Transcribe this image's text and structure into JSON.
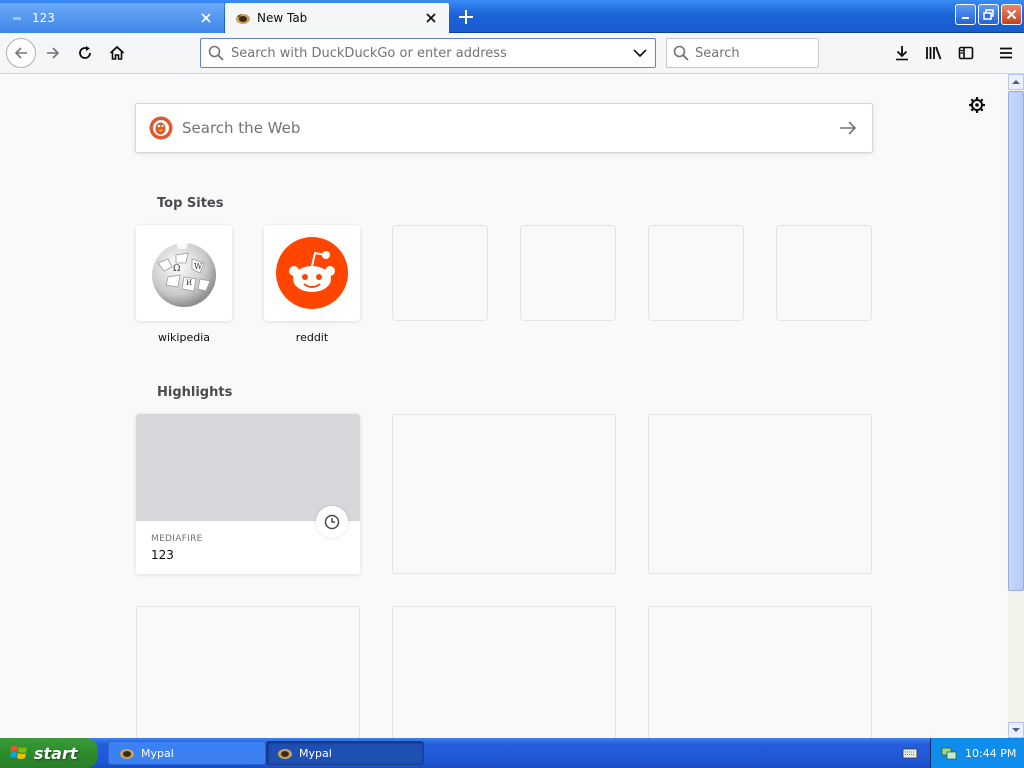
{
  "browser": {
    "tabs": [
      {
        "label": "123",
        "active": false
      },
      {
        "label": "New Tab",
        "active": true
      }
    ],
    "url_placeholder": "Search with DuckDuckGo or enter address",
    "search_placeholder": "Search"
  },
  "newtab": {
    "web_search_placeholder": "Search the Web",
    "top_sites_title": "Top Sites",
    "top_sites": [
      {
        "label": "wikipedia",
        "icon": "wikipedia-globe"
      },
      {
        "label": "reddit",
        "icon": "reddit-alien"
      }
    ],
    "highlights_title": "Highlights",
    "highlights": [
      {
        "source": "MEDIAFIRE",
        "title": "123"
      }
    ]
  },
  "taskbar": {
    "start_label": "start",
    "tasks": [
      {
        "label": "Mypal",
        "active": false
      },
      {
        "label": "Mypal",
        "active": true
      }
    ],
    "clock": "10:44 PM"
  },
  "colors": {
    "titlebar": "#1c63d8",
    "reddit": "#ff4500",
    "ddg": "#de5833",
    "taskbar": "#245edb",
    "start": "#2d8c2d"
  }
}
